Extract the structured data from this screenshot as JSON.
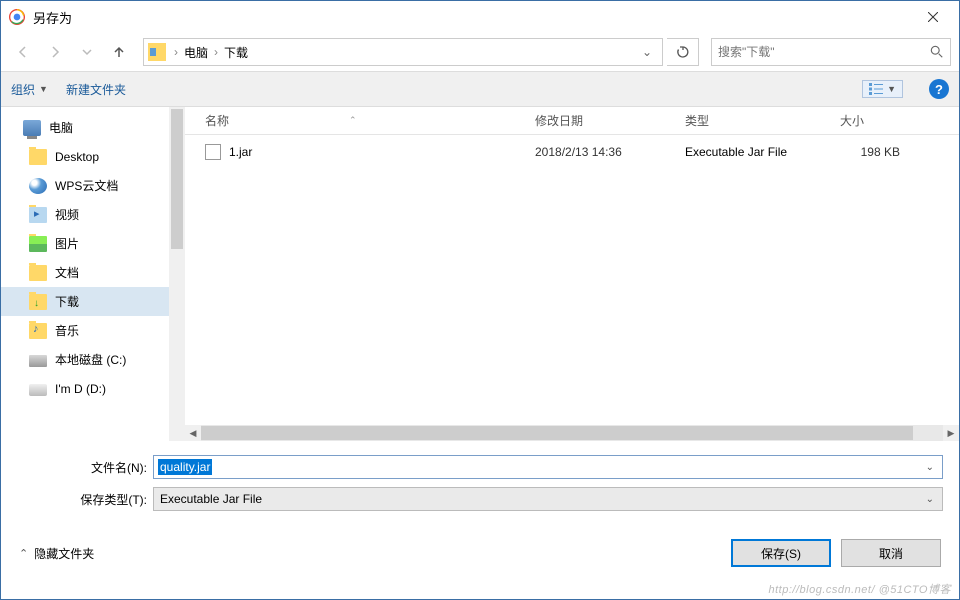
{
  "title": "另存为",
  "breadcrumb": {
    "seg1": "电脑",
    "seg2": "下载"
  },
  "search": {
    "placeholder": "搜索\"下载\""
  },
  "toolbar": {
    "organize": "组织",
    "newfolder": "新建文件夹"
  },
  "sidebar": {
    "items": [
      {
        "label": "电脑"
      },
      {
        "label": "Desktop"
      },
      {
        "label": "WPS云文档"
      },
      {
        "label": "视频"
      },
      {
        "label": "图片"
      },
      {
        "label": "文档"
      },
      {
        "label": "下载"
      },
      {
        "label": "音乐"
      },
      {
        "label": "本地磁盘 (C:)"
      },
      {
        "label": "I'm D (D:)"
      }
    ]
  },
  "columns": {
    "name": "名称",
    "date": "修改日期",
    "type": "类型",
    "size": "大小"
  },
  "files": [
    {
      "name": "1.jar",
      "date": "2018/2/13 14:36",
      "type": "Executable Jar File",
      "size": "198 KB"
    }
  ],
  "form": {
    "filename_label": "文件名(N):",
    "filename_value": "quality.jar",
    "filetype_label": "保存类型(T):",
    "filetype_value": "Executable Jar File"
  },
  "footer": {
    "hide_folders": "隐藏文件夹",
    "save": "保存(S)",
    "cancel": "取消"
  },
  "watermark": "http://blog.csdn.net/ @51CTO博客"
}
